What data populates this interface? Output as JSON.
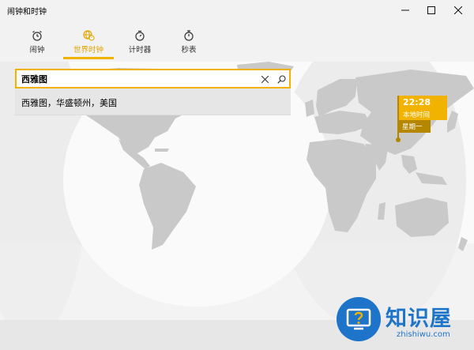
{
  "window": {
    "title": "闹钟和时钟",
    "buttons": [
      "minimize-icon",
      "maximize-icon",
      "close-icon"
    ]
  },
  "tabs": [
    {
      "label": "闹钟",
      "icon": "alarm-clock-icon",
      "active": false
    },
    {
      "label": "世界时钟",
      "icon": "world-clock-icon",
      "active": true
    },
    {
      "label": "计时器",
      "icon": "timer-icon",
      "active": false
    },
    {
      "label": "秒表",
      "icon": "stopwatch-icon",
      "active": false
    }
  ],
  "search": {
    "value": "西雅图",
    "suggestion": "西雅图，华盛顿州，美国"
  },
  "local_clock": {
    "time": "22:28",
    "label": "本地时间",
    "day": "星期一"
  },
  "watermark": {
    "title": "知识屋",
    "subtitle": "zhishiwu.com"
  },
  "colors": {
    "accent": "#f2b300",
    "accent_dark": "#b58600",
    "land": "#c9c9c9",
    "night_shade": "#ececec",
    "watermark_blue": "#1d74c8"
  }
}
